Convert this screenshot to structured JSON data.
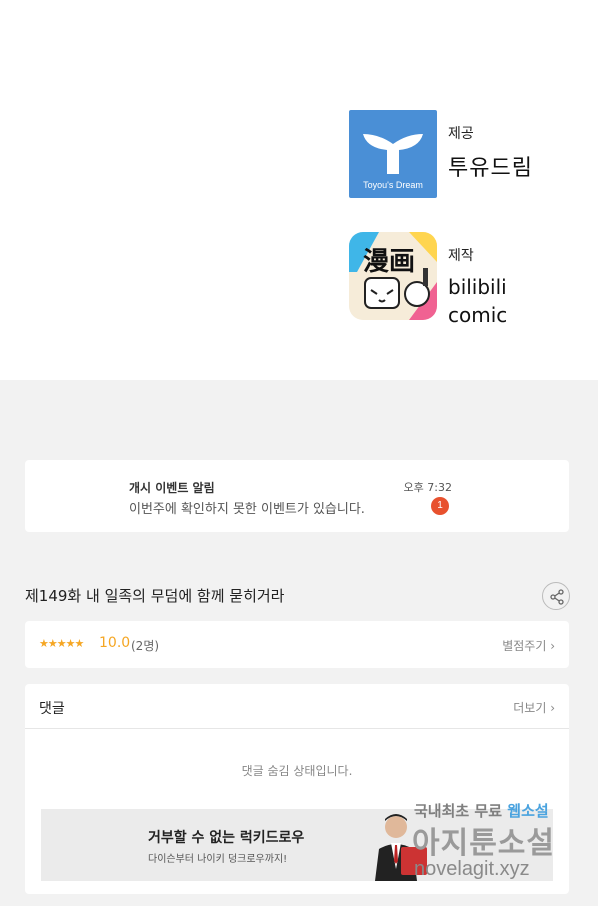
{
  "credits": {
    "provider_role": "제공",
    "provider_name": "투유드림",
    "provider_logo_caption": "Toyou's Dream",
    "producer_role": "제작",
    "producer_name_line1": "bilibili",
    "producer_name_line2": "comic",
    "producer_logo_text": "漫画"
  },
  "notice": {
    "title": "개시 이벤트 알림",
    "body": "이번주에 확인하지 못한 이벤트가 있습니다.",
    "time": "오후 7:32",
    "badge": "1"
  },
  "episode": {
    "title": "제149화 내 일족의 무덤에 함께 묻히거라"
  },
  "rating": {
    "stars": "★★★★★",
    "score": "10.0",
    "count": "(2명)",
    "rate_link": "별점주기 ›"
  },
  "comments": {
    "title": "댓글",
    "more_link": "더보기 ›",
    "hidden_message": "댓글 숨김 상태입니다."
  },
  "ad": {
    "title": "거부할 수 없는 럭키드로우",
    "subtitle": "다이슨부터 나이키 덩크로우까지!"
  },
  "watermark": {
    "line1_a": "국내최초 무료",
    "line1_b": "웹소설",
    "line2": "아지툰소설",
    "line3": "novelagit.xyz"
  },
  "colors": {
    "toyou_blue": "#4a8fd6",
    "badge_red": "#e8512e",
    "star_orange": "#f5a623",
    "gray_bg": "#f2f2f2"
  }
}
